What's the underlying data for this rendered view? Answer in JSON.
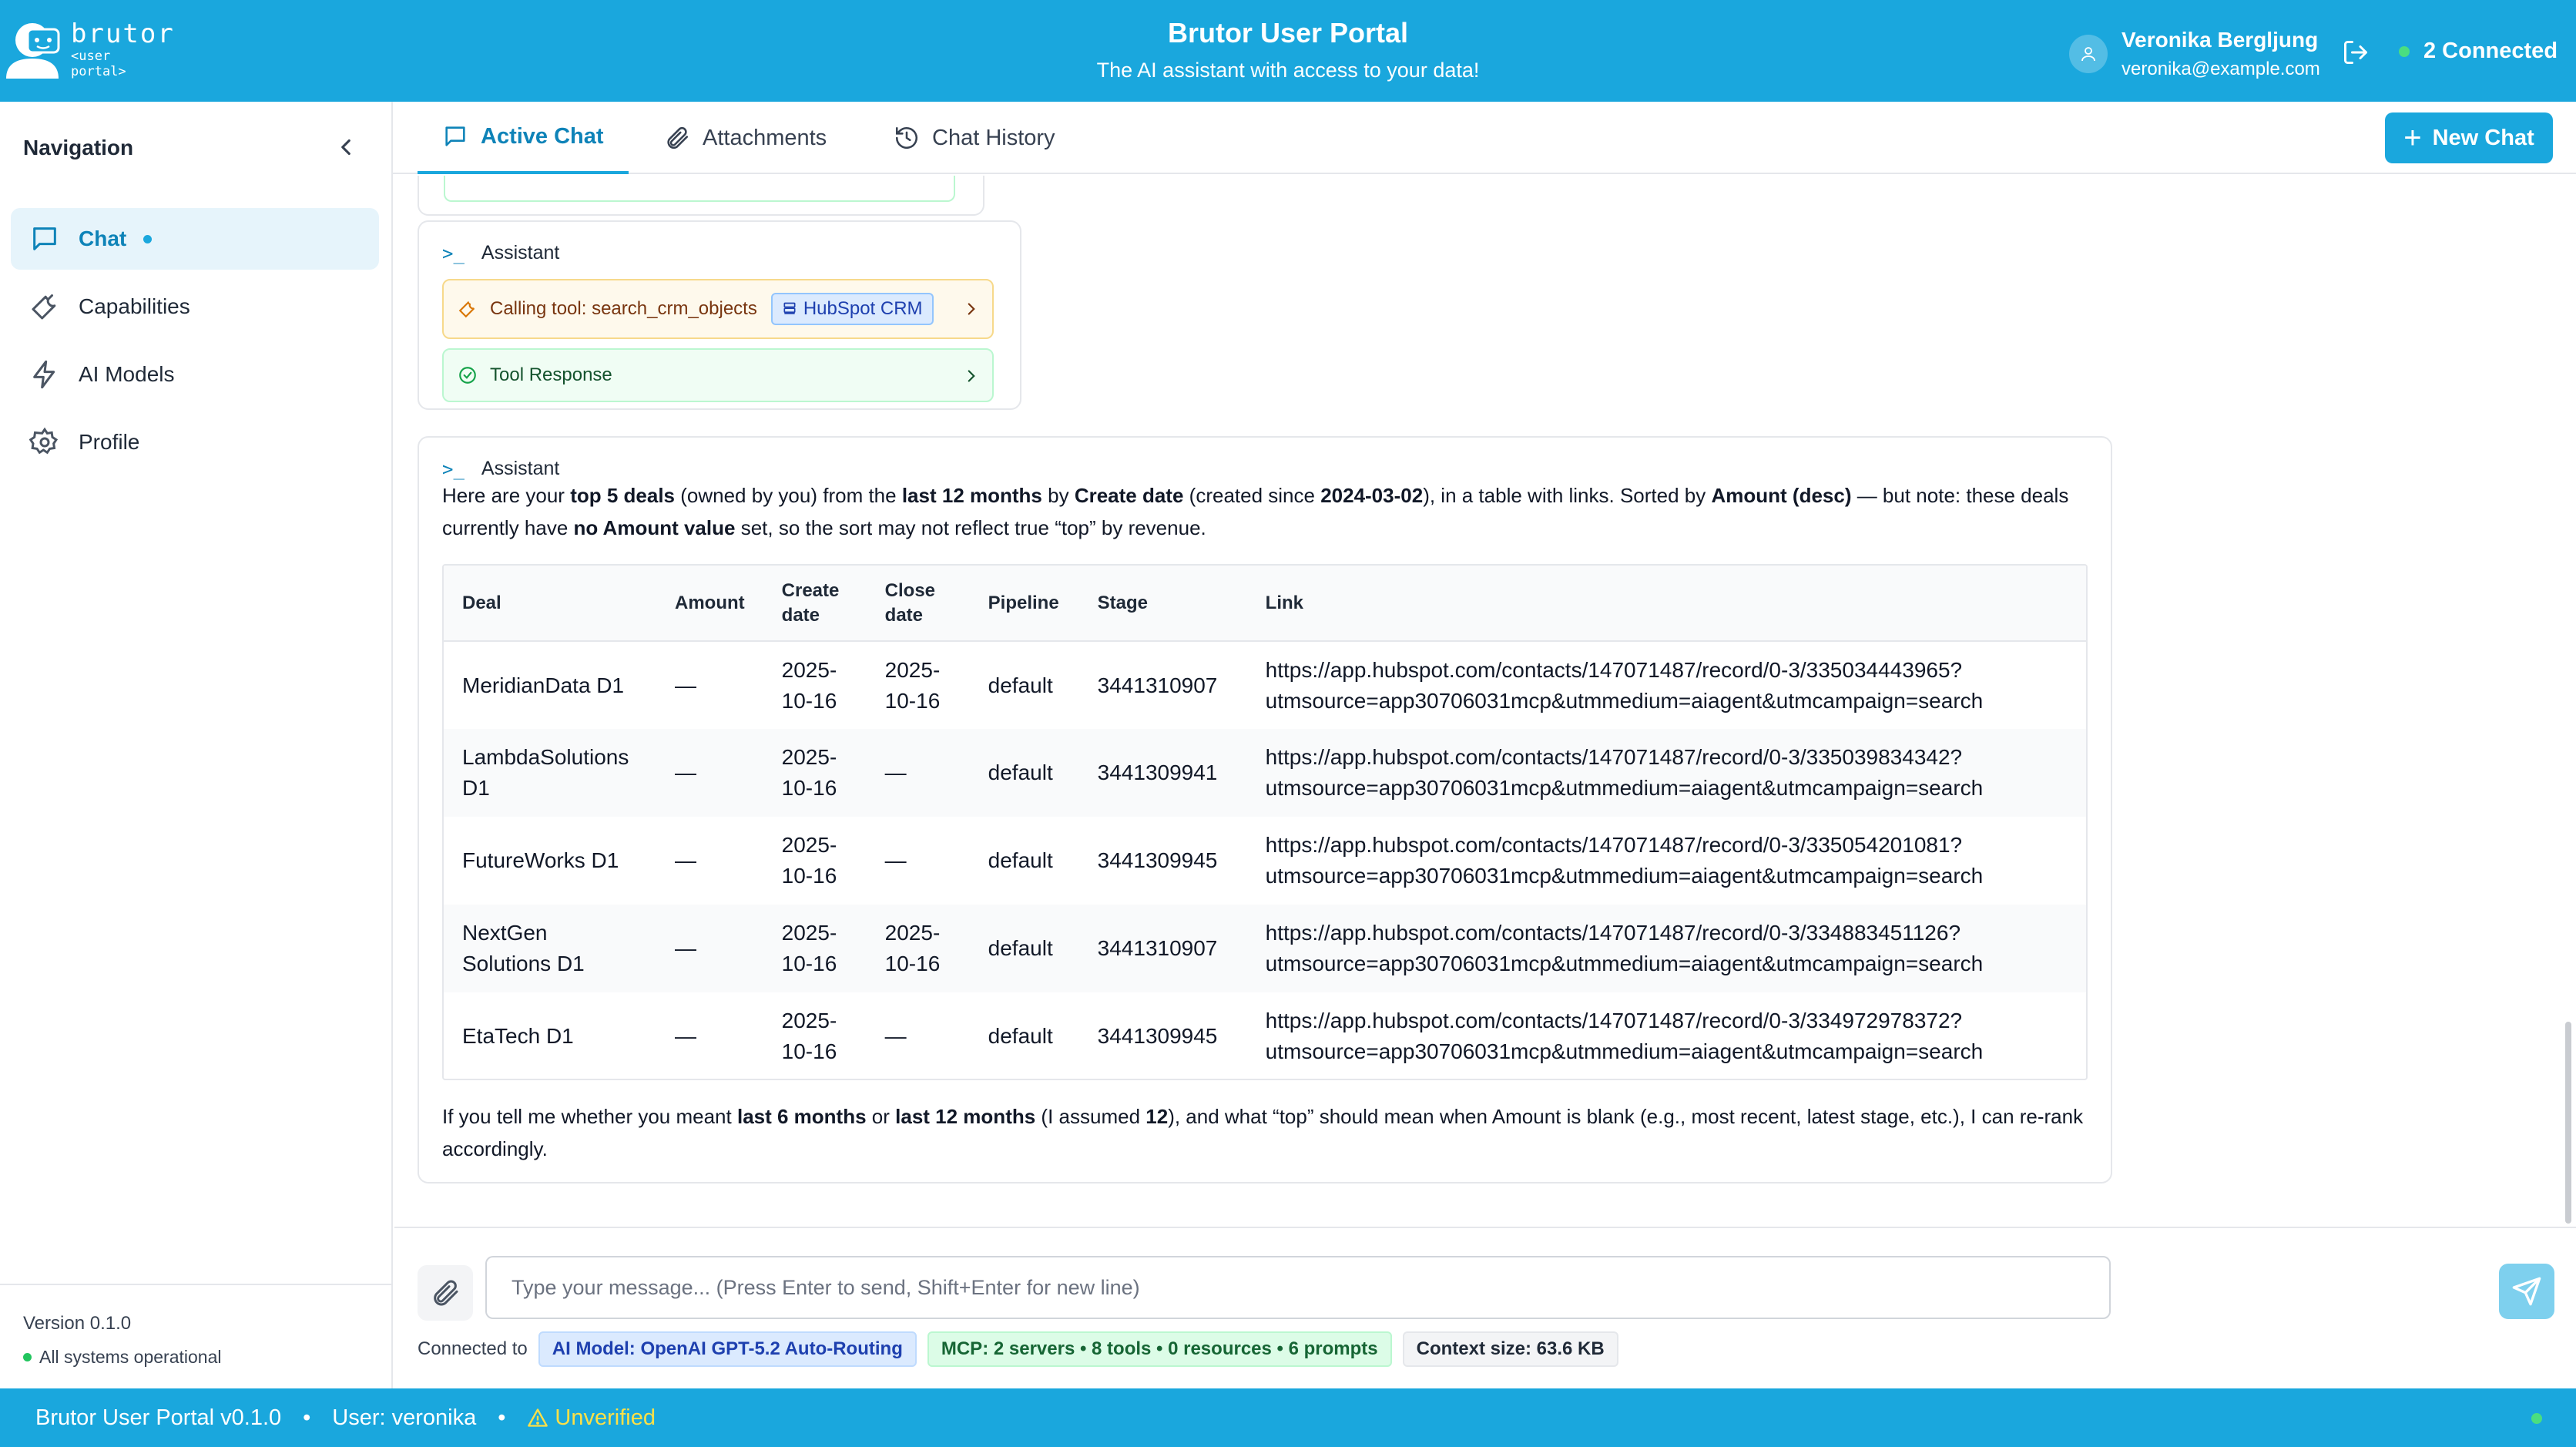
{
  "header": {
    "logo_name": "brutor",
    "logo_sub_1": "<user",
    "logo_sub_2": "portal>",
    "title": "Brutor User Portal",
    "subtitle": "The AI assistant with access to your data!",
    "user_name": "Veronika Bergljung",
    "user_email": "veronika@example.com",
    "connected_label": "2 Connected"
  },
  "sidebar": {
    "heading": "Navigation",
    "items": [
      {
        "label": "Chat",
        "icon": "chat-bubble-icon",
        "active": true
      },
      {
        "label": "Capabilities",
        "icon": "wrench-icon"
      },
      {
        "label": "AI Models",
        "icon": "lightning-icon"
      },
      {
        "label": "Profile",
        "icon": "gear-icon"
      }
    ],
    "version": "Version 0.1.0",
    "system_status": "All systems operational"
  },
  "tabs": [
    {
      "label": "Active Chat",
      "icon": "chat-bubble-icon",
      "active": true
    },
    {
      "label": "Attachments",
      "icon": "paperclip-icon"
    },
    {
      "label": "Chat History",
      "icon": "history-icon"
    }
  ],
  "new_chat_label": "New Chat",
  "messages": {
    "assistant_label": "Assistant",
    "tool_call_prefix": "Calling tool: search_crm_objects",
    "tool_badge": "HubSpot CRM",
    "tool_response_label": "Tool Response",
    "intro": {
      "t1": "Here are your ",
      "b1": "top 5 deals",
      "t2": " (owned by you) from the ",
      "b2": "last 12 months",
      "t3": " by ",
      "b3": "Create date",
      "t4": " (created since ",
      "b4": "2024-03-02",
      "t5": "), in a table with links. Sorted by ",
      "b5": "Amount (desc)",
      "t6": " — but note: these deals currently have ",
      "b6": "no Amount value",
      "t7": " set, so the sort may not reflect true “top” by revenue."
    },
    "outro": {
      "t1": "If you tell me whether you meant ",
      "b1": "last 6 months",
      "t2": " or ",
      "b2": "last 12 months",
      "t3": " (I assumed ",
      "b3": "12",
      "t4": "), and what “top” should mean when Amount is blank (e.g., most recent, latest stage, etc.), I can re-rank accordingly."
    }
  },
  "deals_table": {
    "headers": [
      "Deal",
      "Amount",
      "Create date",
      "Close date",
      "Pipeline",
      "Stage",
      "Link"
    ],
    "rows": [
      {
        "deal": "MeridianData D1",
        "amount": "—",
        "create": "2025-10-16",
        "close": "2025-10-16",
        "pipeline": "default",
        "stage": "3441310907",
        "link": "https://app.hubspot.com/contacts/147071487/record/0-3/335034443965?utmsource=app30706031mcp&utmmedium=aiagent&utmcampaign=search"
      },
      {
        "deal": "LambdaSolutions D1",
        "amount": "—",
        "create": "2025-10-16",
        "close": "—",
        "pipeline": "default",
        "stage": "3441309941",
        "link": "https://app.hubspot.com/contacts/147071487/record/0-3/335039834342?utmsource=app30706031mcp&utmmedium=aiagent&utmcampaign=search"
      },
      {
        "deal": "FutureWorks D1",
        "amount": "—",
        "create": "2025-10-16",
        "close": "—",
        "pipeline": "default",
        "stage": "3441309945",
        "link": "https://app.hubspot.com/contacts/147071487/record/0-3/335054201081?utmsource=app30706031mcp&utmmedium=aiagent&utmcampaign=search"
      },
      {
        "deal": "NextGen Solutions D1",
        "amount": "—",
        "create": "2025-10-16",
        "close": "2025-10-16",
        "pipeline": "default",
        "stage": "3441310907",
        "link": "https://app.hubspot.com/contacts/147071487/record/0-3/334883451126?utmsource=app30706031mcp&utmmedium=aiagent&utmcampaign=search"
      },
      {
        "deal": "EtaTech D1",
        "amount": "—",
        "create": "2025-10-16",
        "close": "—",
        "pipeline": "default",
        "stage": "3441309945",
        "link": "https://app.hubspot.com/contacts/147071487/record/0-3/334972978372?utmsource=app30706031mcp&utmmedium=aiagent&utmcampaign=search"
      }
    ]
  },
  "input": {
    "placeholder": "Type your message... (Press Enter to send, Shift+Enter for new line)",
    "value": "",
    "connected_to": "Connected to",
    "ai_model": "AI Model: OpenAI GPT-5.2 Auto-Routing",
    "mcp": "MCP: 2 servers • 8 tools • 0 resources • 6 prompts",
    "context_size": "Context size: 63.6 KB"
  },
  "footer": {
    "app": "Brutor User Portal v0.1.0",
    "sep": "•",
    "user": "User: veronika",
    "verification": "Unverified"
  },
  "colors": {
    "brand": "#1aa7dd",
    "brand_dark": "#0e83b8",
    "status_green": "#4ade80",
    "warning": "#fde047"
  }
}
